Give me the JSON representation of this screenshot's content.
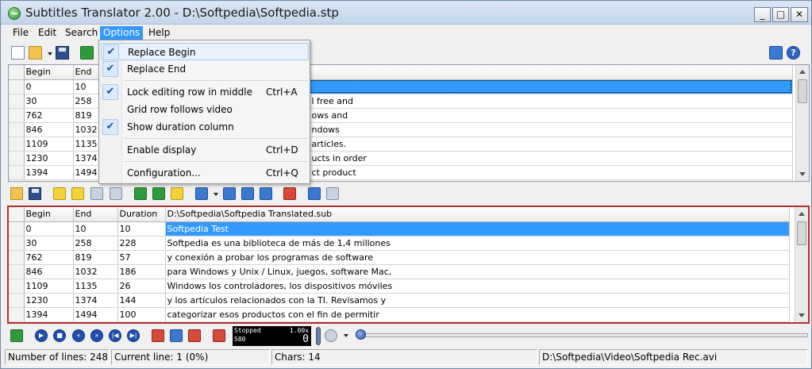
{
  "window": {
    "title": "Subtitles Translator 2.00 - D:\\Softpedia\\Softpedia.stp",
    "minimize": "_",
    "maximize": "□",
    "close": "✕"
  },
  "menubar": {
    "items": [
      {
        "label": "File"
      },
      {
        "label": "Edit"
      },
      {
        "label": "Search"
      },
      {
        "label": "Options"
      },
      {
        "label": "Help"
      }
    ],
    "active": "Options"
  },
  "options_menu": {
    "items": [
      {
        "label": "Replace Begin",
        "checked": true,
        "shortcut": ""
      },
      {
        "label": "Replace End",
        "checked": true,
        "shortcut": ""
      },
      {
        "label": "Lock editing row in middle",
        "checked": true,
        "shortcut": "Ctrl+A"
      },
      {
        "label": "Grid row follows video",
        "checked": false,
        "shortcut": ""
      },
      {
        "label": "Show duration column",
        "checked": true,
        "shortcut": ""
      },
      {
        "label": "Enable display",
        "checked": false,
        "shortcut": "Ctrl+D"
      },
      {
        "label": "Configuration...",
        "checked": false,
        "shortcut": "Ctrl+Q"
      }
    ],
    "check_glyph": "✔"
  },
  "top_grid": {
    "headers": [
      "Begin",
      "End"
    ],
    "rows": [
      {
        "begin": "0",
        "end": "10",
        "text": ""
      },
      {
        "begin": "30",
        "end": "258",
        "text": "l free and"
      },
      {
        "begin": "762",
        "end": "819",
        "text": "ows and"
      },
      {
        "begin": "846",
        "end": "1032",
        "text": "ndows"
      },
      {
        "begin": "1109",
        "end": "1135",
        "text": "articles."
      },
      {
        "begin": "1230",
        "end": "1374",
        "text": "ucts in order"
      },
      {
        "begin": "1394",
        "end": "1494",
        "text": "ct product"
      }
    ]
  },
  "bottom_grid": {
    "headers": [
      "Begin",
      "End",
      "Duration",
      "D:\\Softpedia\\Softpedia Translated.sub"
    ],
    "rows": [
      {
        "begin": "0",
        "end": "10",
        "duration": "10",
        "text": "Softpedia Test"
      },
      {
        "begin": "30",
        "end": "258",
        "duration": "228",
        "text": "Softpedia es una biblioteca de más de 1,4 millones"
      },
      {
        "begin": "762",
        "end": "819",
        "duration": "57",
        "text": "y conexión a probar los programas de software"
      },
      {
        "begin": "846",
        "end": "1032",
        "duration": "186",
        "text": "para Windows y Unix / Linux, juegos, software Mac,"
      },
      {
        "begin": "1109",
        "end": "1135",
        "duration": "26",
        "text": "Windows los controladores, los dispositivos móviles"
      },
      {
        "begin": "1230",
        "end": "1374",
        "duration": "144",
        "text": "y los artículos relacionados con la TI. Revisamos y"
      },
      {
        "begin": "1394",
        "end": "1494",
        "duration": "100",
        "text": "categorizar esos productos con el fin de permitir"
      }
    ]
  },
  "player": {
    "status": "Stopped",
    "position": "580",
    "speed": "1.00x",
    "counter": "0"
  },
  "statusbar": {
    "lines": "Number of lines: 248",
    "current": "Current line: 1 (0%)",
    "chars": "Chars: 14",
    "video": "D:\\Softpedia\\Video\\Softpedia Rec.avi"
  }
}
